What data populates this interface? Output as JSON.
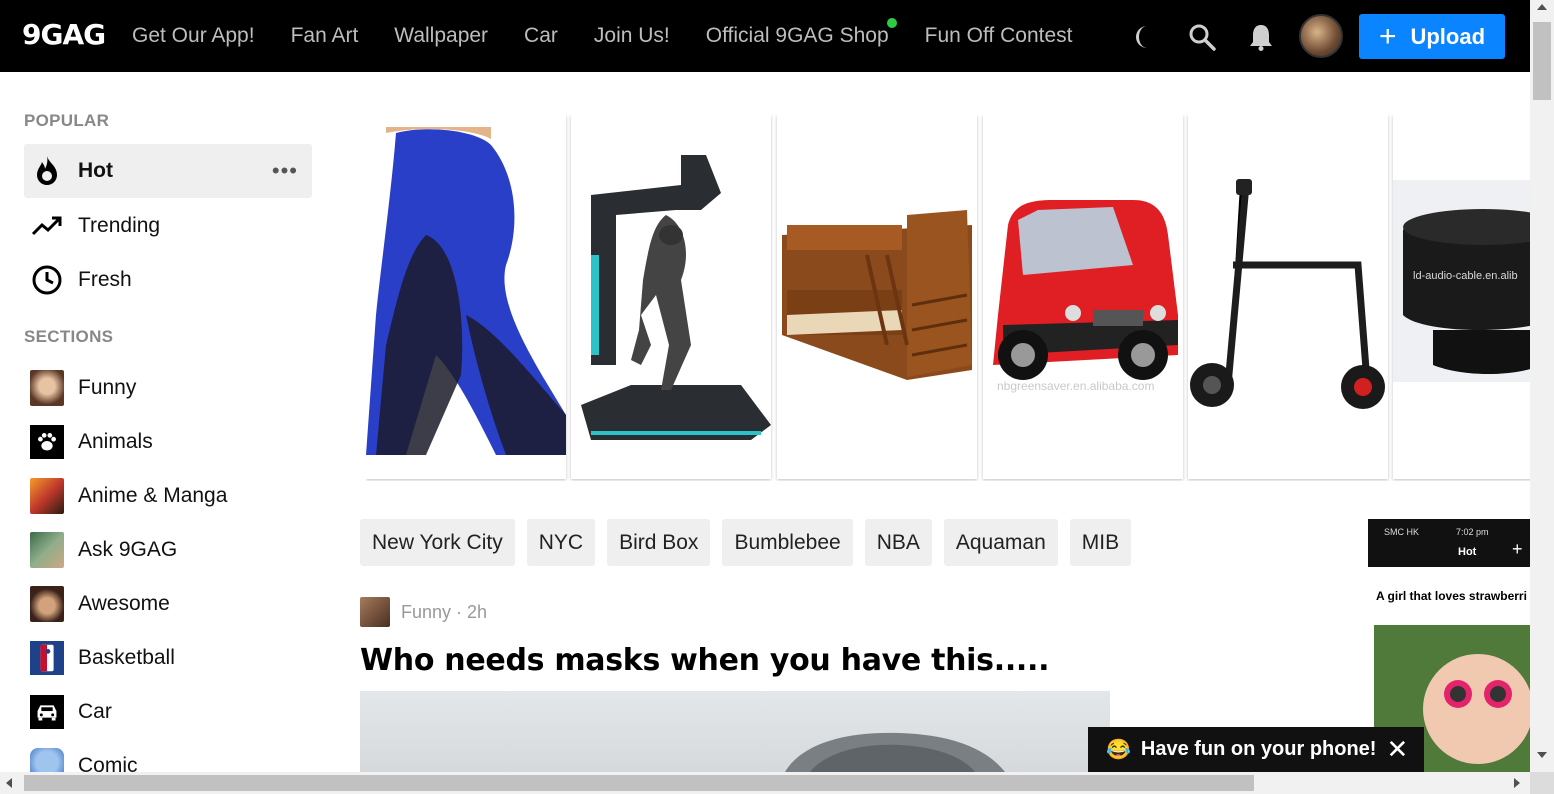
{
  "header": {
    "logo": "9GAG",
    "nav": [
      "Get Our App!",
      "Fan Art",
      "Wallpaper",
      "Car",
      "Join Us!",
      "Official 9GAG Shop",
      "Fun Off Contest"
    ],
    "upload_label": "Upload",
    "upload_color": "#0b84ff",
    "shop_dot_color": "#2ecc40",
    "icons": [
      "moon-icon",
      "search-icon",
      "bell-icon"
    ]
  },
  "sidebar": {
    "popular_title": "POPULAR",
    "popular": [
      {
        "label": "Hot",
        "icon": "fire-icon",
        "active": true
      },
      {
        "label": "Trending",
        "icon": "trending-icon"
      },
      {
        "label": "Fresh",
        "icon": "clock-icon"
      }
    ],
    "sections_title": "SECTIONS",
    "sections": [
      {
        "label": "Funny",
        "icon": "funny-thumb"
      },
      {
        "label": "Animals",
        "icon": "paw-icon"
      },
      {
        "label": "Anime & Manga",
        "icon": "anime-thumb"
      },
      {
        "label": "Ask 9GAG",
        "icon": "ask-thumb"
      },
      {
        "label": "Awesome",
        "icon": "awesome-thumb"
      },
      {
        "label": "Basketball",
        "icon": "nba-icon"
      },
      {
        "label": "Car",
        "icon": "car-icon"
      },
      {
        "label": "Comic",
        "icon": "comic-thumb"
      }
    ]
  },
  "carousel": {
    "products": [
      "leggings-image",
      "vr-simulator-image",
      "bunk-bed-image",
      "mini-car-image",
      "electric-scooter-image",
      "subwoofer-image"
    ],
    "watermarks": [
      "nbgreensaver.en.alibaba.com",
      "ld-audio-cable.en.alib"
    ]
  },
  "tags": [
    "New York City",
    "NYC",
    "Bird Box",
    "Bumblebee",
    "NBA",
    "Aquaman",
    "MIB"
  ],
  "post": {
    "section": "Funny",
    "age": "2h",
    "meta": "Funny · 2h",
    "title": "Who needs masks when you have this....."
  },
  "side_ad": {
    "status": "SMC HK",
    "time": "7:02 pm",
    "tab": "Hot",
    "caption": "A girl that loves strawberri"
  },
  "toast": {
    "emoji": "😂",
    "message": "Have fun on your phone!",
    "close": "✕"
  }
}
